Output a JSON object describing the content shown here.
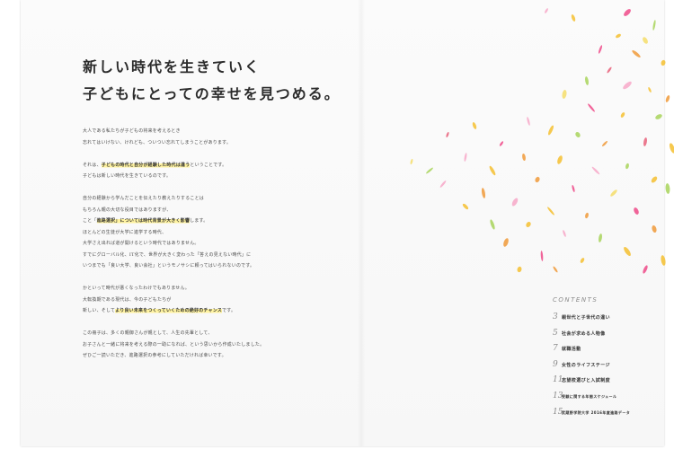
{
  "headline": {
    "line1": "新しい時代を生きていく",
    "line2": "子どもにとっての幸せを見つめる。"
  },
  "body": {
    "p1": [
      "大人である私たちが子どもの将来を考えるとき",
      "忘れてはいけない、けれども、ついつい忘れてしまうことがあります。"
    ],
    "p2": {
      "pre": "それは、",
      "mark": "子どもの時代と自分が経験した時代は違う",
      "post": "ということです。",
      "line2": "子どもは新しい時代を生きているのです。"
    },
    "p3": {
      "line1": "自分の経験から学んだことを伝えたり教えたりすることは",
      "line2": "もちろん親の大切な役目ではありますが、",
      "line3_pre": "こと「",
      "line3_mark": "進路選択」については時代背景が大きく影響",
      "line3_post": "します。",
      "line4": "ほとんどの生徒が大学に進学する時代、",
      "line5": "大学さえ出れば道が開けるという時代ではありません。",
      "line6": "すでにグローバル化、IT化で、世界が大きく変わった「答えの見えない時代」に",
      "line7": "いつまでも「良い大学、良い会社」というモノサシに頼ってはいられないのです。"
    },
    "p4": {
      "line1": "かといって時代が悪くなったわけでもありません。",
      "line2": "大転換期である現代は、今の子どもたちが",
      "line3_pre": "新しい、そして",
      "line3_mark": "より良い未来をつくっていくための絶好のチャンス",
      "line3_post": "です。"
    },
    "p5": [
      "この冊子は、多くの親御さんが親として、人生の先輩として、",
      "お子さんと一緒に将来を考える際の一助になれば、という思いから作成いたしました。",
      "ぜひご一読いただき、進路選択の参考にしていただければ幸いです。"
    ]
  },
  "contents": {
    "title": "CONTENTS",
    "items": [
      {
        "num": "3",
        "label": "親世代と子世代の違い"
      },
      {
        "num": "5",
        "label": "社会が求める人物像"
      },
      {
        "num": "7",
        "label": "就職活動"
      },
      {
        "num": "9",
        "label": "女性のライフステージ"
      },
      {
        "num": "11",
        "label": "志望校選びと入試制度"
      },
      {
        "num": "13",
        "label": "受験に関する年間スケジュール"
      },
      {
        "num": "15",
        "label": "武蔵野学院大学 2016年度進路データ"
      }
    ]
  },
  "petal_colors": [
    "#f7a8c8",
    "#f5c030",
    "#ee4a88",
    "#a8d35a",
    "#f09a3a",
    "#f4dd6a",
    "#e8607a",
    "#ffffff"
  ]
}
